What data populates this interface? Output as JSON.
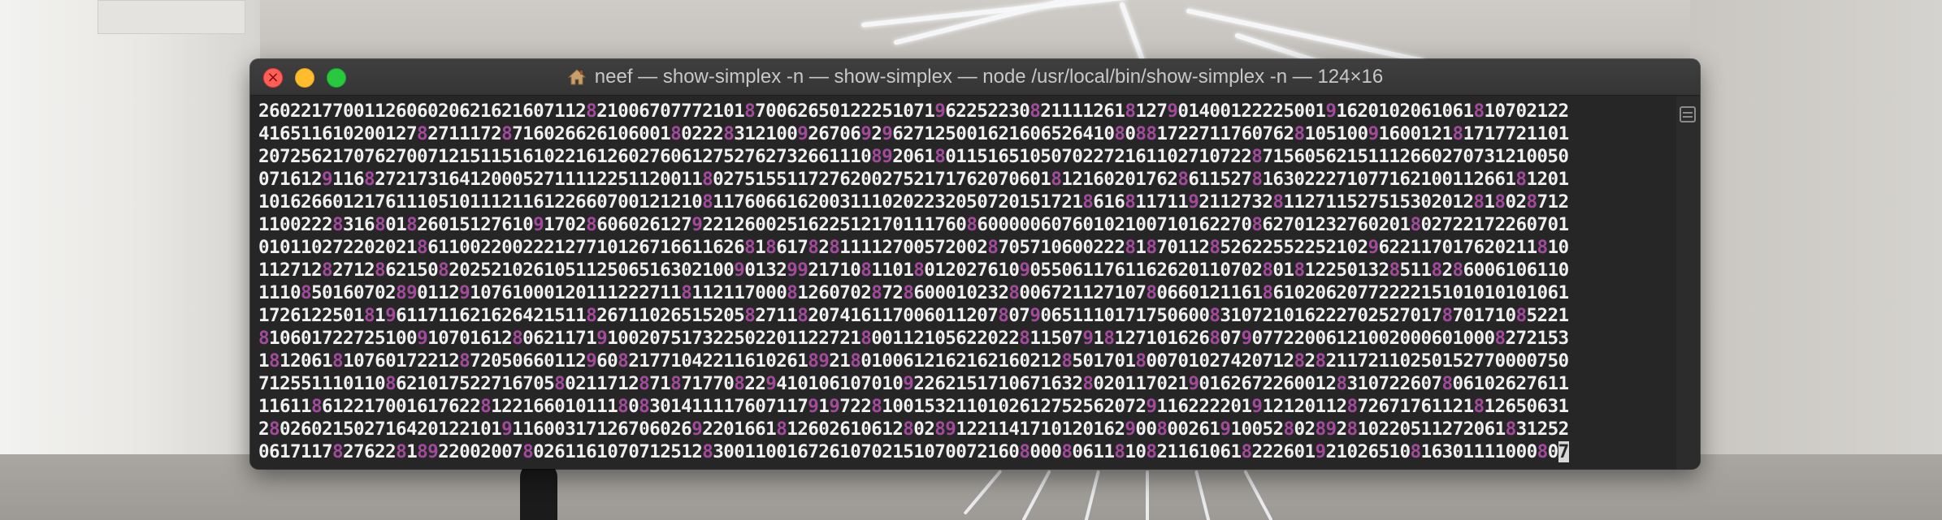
{
  "window": {
    "title": "neef — show-simplex -n — show-simplex — node /usr/local/bin/show-simplex -n — 124×16",
    "title_icon": "home-icon",
    "controls": {
      "close": "close-button",
      "minimize": "minimize-button",
      "maximize": "maximize-button"
    }
  },
  "colors": {
    "text": "#f0f0f0",
    "highlight": "#a24a9b",
    "background": "#262626"
  },
  "terminal": {
    "highlight_digits": [
      "8",
      "9"
    ],
    "lines": [
      "2602217700112606020621621607112821006707772101870062650122251071962252230821111261812790140012222500191620102061061810702122",
      "4165116102001278271117287160266261060018022283121009267069296271250016216065264108088172271176076281051009160012181717721101",
      "2072562170762700712151151610221612602760612752762732661110892061801151651050702272161102710722871560562151112660270731210050",
      "0716129116827217316412000527111122511200118027515511727620027521717620706018121602017628611527816302227107716210011266181201",
      "1016266012176111051011121161226607001212108117606616200311102022320507201517218616811711921127328112711527515302012818028712",
      "1100222831680182601512761091702860602612792212600251622512170111760860000060760102100710162270862701232760201802722172260701",
      "0101102722020218611002200222127710126716611626818617828111127005720028705710600222818701128526225522521029622117017620211810",
      "1127128271286215082025210261051125065163021009013299217108110180120276109055061176116262011070280181225013285118286006106110",
      "1110850160702890112910761000120111222711811211700081260702872860001023280067211271078066012116186102062077222215101010101061",
      "1726122501819611711621626421511826711026515205827118207416117006011207807906511101717506008310721016222702527017870171085221",
      "8106017227251009107016128062117191002075173225022011227218001121056220228115079181271016268079077220061210020006010008272153",
      "1812061810760172212872050660112960821771042211610261892180100612162162160212850170180070102742071282821172110250152770000750",
      "7125511101108621017522716705802117128718717708229410106107010922621517106716328020117021901626722600128310722607806102627611",
      "1161186122170016176228122166010111808301411117607117919722810015321101026127525620729116222201912120112872671761121812650631",
      "2802602150271642012210191160031712670602692201661812602610612802891221141710120162900800261910052802892810220511272061831252",
      "0617117827622818922002007802611610707125128300110016726107021510700721608000806118108211610618222601921026510816301111000807"
    ]
  }
}
